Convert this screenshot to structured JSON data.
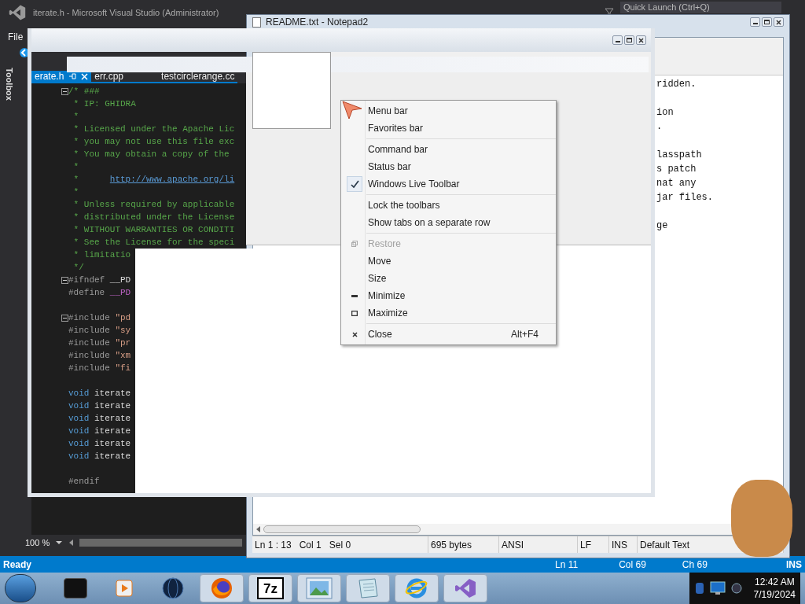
{
  "vs": {
    "title": "iterate.h - Microsoft Visual Studio (Administrator)",
    "quick_launch": {
      "placeholder": "Quick Launch (Ctrl+Q)"
    },
    "menu": [
      "File"
    ],
    "toolbox": "Toolbox",
    "tabs": [
      {
        "label": "erate.h",
        "selected": true
      },
      {
        "label": "err.cpp",
        "selected": false
      },
      {
        "label": "testcirclerange.cc",
        "selected": false
      }
    ],
    "code": [
      {
        "fold": true,
        "segments": [
          {
            "kind": "comment",
            "text": "/* ###"
          }
        ]
      },
      {
        "segments": [
          {
            "kind": "comment",
            "text": " * IP: GHIDRA"
          }
        ]
      },
      {
        "segments": [
          {
            "kind": "comment",
            "text": " *"
          }
        ]
      },
      {
        "segments": [
          {
            "kind": "comment",
            "text": " * Licensed under the Apache Lic"
          }
        ]
      },
      {
        "segments": [
          {
            "kind": "comment",
            "text": " * you may not use this file exc"
          }
        ]
      },
      {
        "segments": [
          {
            "kind": "comment",
            "text": " * You may obtain a copy of the"
          }
        ]
      },
      {
        "segments": [
          {
            "kind": "comment",
            "text": " *"
          }
        ]
      },
      {
        "segments": [
          {
            "kind": "comment",
            "text": " *      "
          },
          {
            "kind": "link",
            "text": "http://www.apache.org/li"
          }
        ]
      },
      {
        "segments": [
          {
            "kind": "comment",
            "text": " *"
          }
        ]
      },
      {
        "segments": [
          {
            "kind": "comment",
            "text": " * Unless required by applicable"
          }
        ]
      },
      {
        "segments": [
          {
            "kind": "comment",
            "text": " * distributed under the License"
          }
        ]
      },
      {
        "segments": [
          {
            "kind": "comment",
            "text": " * WITHOUT WARRANTIES OR CONDITI"
          }
        ]
      },
      {
        "segments": [
          {
            "kind": "comment",
            "text": " * See the License for the speci"
          }
        ]
      },
      {
        "segments": [
          {
            "kind": "comment",
            "text": " * limitatio"
          }
        ]
      },
      {
        "segments": [
          {
            "kind": "comment",
            "text": " */"
          }
        ]
      },
      {
        "fold": true,
        "segments": [
          {
            "kind": "directive",
            "text": "#ifndef "
          },
          {
            "kind": "plain",
            "text": "__PD"
          }
        ]
      },
      {
        "segments": [
          {
            "kind": "directive",
            "text": "#define "
          },
          {
            "kind": "macro",
            "text": "__PD"
          }
        ]
      },
      {
        "fold": true,
        "space_before": true,
        "segments": [
          {
            "kind": "directive",
            "text": "#include "
          },
          {
            "kind": "string",
            "text": "\"pd"
          }
        ]
      },
      {
        "segments": [
          {
            "kind": "directive",
            "text": "#include "
          },
          {
            "kind": "string",
            "text": "\"sy"
          }
        ]
      },
      {
        "segments": [
          {
            "kind": "directive",
            "text": "#include "
          },
          {
            "kind": "string",
            "text": "\"pr"
          }
        ]
      },
      {
        "segments": [
          {
            "kind": "directive",
            "text": "#include "
          },
          {
            "kind": "string",
            "text": "\"xm"
          }
        ]
      },
      {
        "segments": [
          {
            "kind": "directive",
            "text": "#include "
          },
          {
            "kind": "string",
            "text": "\"fi"
          }
        ]
      },
      {
        "space_before": true,
        "segments": [
          {
            "kind": "keyword",
            "text": "void "
          },
          {
            "kind": "plain",
            "text": "iterate"
          }
        ]
      },
      {
        "segments": [
          {
            "kind": "keyword",
            "text": "void "
          },
          {
            "kind": "plain",
            "text": "iterate"
          }
        ]
      },
      {
        "segments": [
          {
            "kind": "keyword",
            "text": "void "
          },
          {
            "kind": "plain",
            "text": "iterate"
          }
        ]
      },
      {
        "segments": [
          {
            "kind": "keyword",
            "text": "void "
          },
          {
            "kind": "plain",
            "text": "iterate"
          }
        ]
      },
      {
        "segments": [
          {
            "kind": "keyword",
            "text": "void "
          },
          {
            "kind": "plain",
            "text": "iterate"
          }
        ]
      },
      {
        "segments": [
          {
            "kind": "keyword",
            "text": "void "
          },
          {
            "kind": "plain",
            "text": "iterate"
          }
        ]
      },
      {
        "space_before": true,
        "segments": [
          {
            "kind": "directive",
            "text": "#endif"
          }
        ]
      }
    ],
    "zoom": "100 %",
    "status_bar": {
      "state": "Ready",
      "line": "Ln 11",
      "col": "Col 69",
      "ch": "Ch 69",
      "mode": "INS"
    }
  },
  "notepad": {
    "title": "README.txt - Notepad2",
    "lines": [
      {
        "text": "ridden."
      },
      {
        "text": "ion",
        "space_before": true
      },
      {
        "text": "."
      },
      {
        "text": "lasspath",
        "space_before": true
      },
      {
        "text": "s patch"
      },
      {
        "text": "nat any"
      },
      {
        "text": "jar files."
      },
      {
        "text": "ge",
        "space_before": true
      }
    ],
    "status_bar": [
      "Ln 1 : 13   Col 1   Sel 0",
      "695 bytes",
      "ANSI",
      "LF",
      "INS",
      "Default Text"
    ]
  },
  "context_menu": {
    "groups": [
      [
        {
          "label": "Menu bar",
          "checked": false
        },
        {
          "label": "Favorites bar",
          "checked": false
        }
      ],
      [
        {
          "label": "Command bar",
          "checked": false
        },
        {
          "label": "Status bar",
          "checked": false
        },
        {
          "label": "Windows Live Toolbar",
          "checked": true
        }
      ],
      [
        {
          "label": "Lock the toolbars",
          "checked": false
        },
        {
          "label": "Show tabs on a separate row",
          "checked": false
        }
      ],
      [
        {
          "label": "Restore",
          "kind": "restore",
          "disabled": true
        },
        {
          "label": "Move",
          "kind": "plain",
          "disabled": false
        },
        {
          "label": "Size",
          "kind": "plain",
          "disabled": false
        },
        {
          "label": "Minimize",
          "kind": "minimize",
          "disabled": false
        },
        {
          "label": "Maximize",
          "kind": "maximize",
          "disabled": false
        }
      ],
      [
        {
          "label": "Close",
          "kind": "close",
          "disabled": false,
          "shortcut": "Alt+F4"
        }
      ]
    ]
  },
  "taskbar": {
    "apps": [
      {
        "kind": "terminal"
      },
      {
        "kind": "media"
      },
      {
        "kind": "globe"
      },
      {
        "kind": "firefox"
      },
      {
        "kind": "archive",
        "label": "7z"
      },
      {
        "kind": "photos"
      },
      {
        "kind": "notepad"
      },
      {
        "kind": "browser"
      },
      {
        "kind": "studio"
      }
    ],
    "time": "12:42 AM",
    "date": "7/19/2024"
  }
}
